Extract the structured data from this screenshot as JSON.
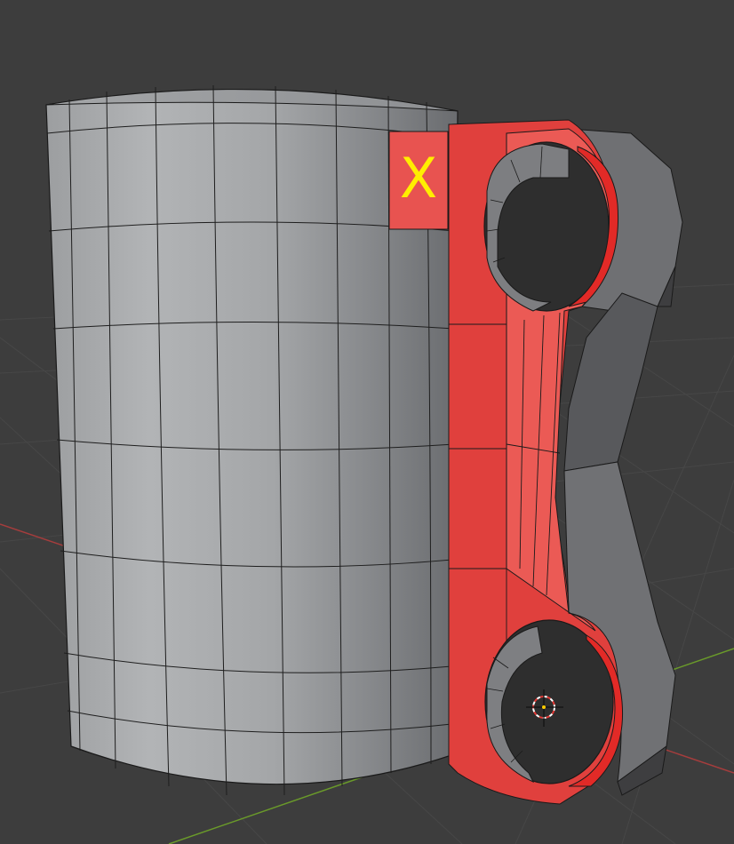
{
  "viewport": {
    "background": "#3d3d3d",
    "grid_color": "#474747",
    "axis_x_color": "#a53d3d",
    "axis_y_color": "#6a9a2a"
  },
  "mesh": {
    "cylinder": {
      "face_color": "#a9abad",
      "edge_color": "#1a1a1a"
    },
    "bracket": {
      "selected_face_color": "#e0403d",
      "selected_face_light": "#eb5a55",
      "unselected_face_color": "#6f7073",
      "dark_face_color": "#3e3e40"
    }
  },
  "annotation": {
    "label": "X",
    "color": "#ffee00",
    "marker_face_color": "#e85350"
  },
  "cursor_3d": {
    "ring_color_a": "#e53935",
    "ring_color_b": "#ffffff"
  }
}
